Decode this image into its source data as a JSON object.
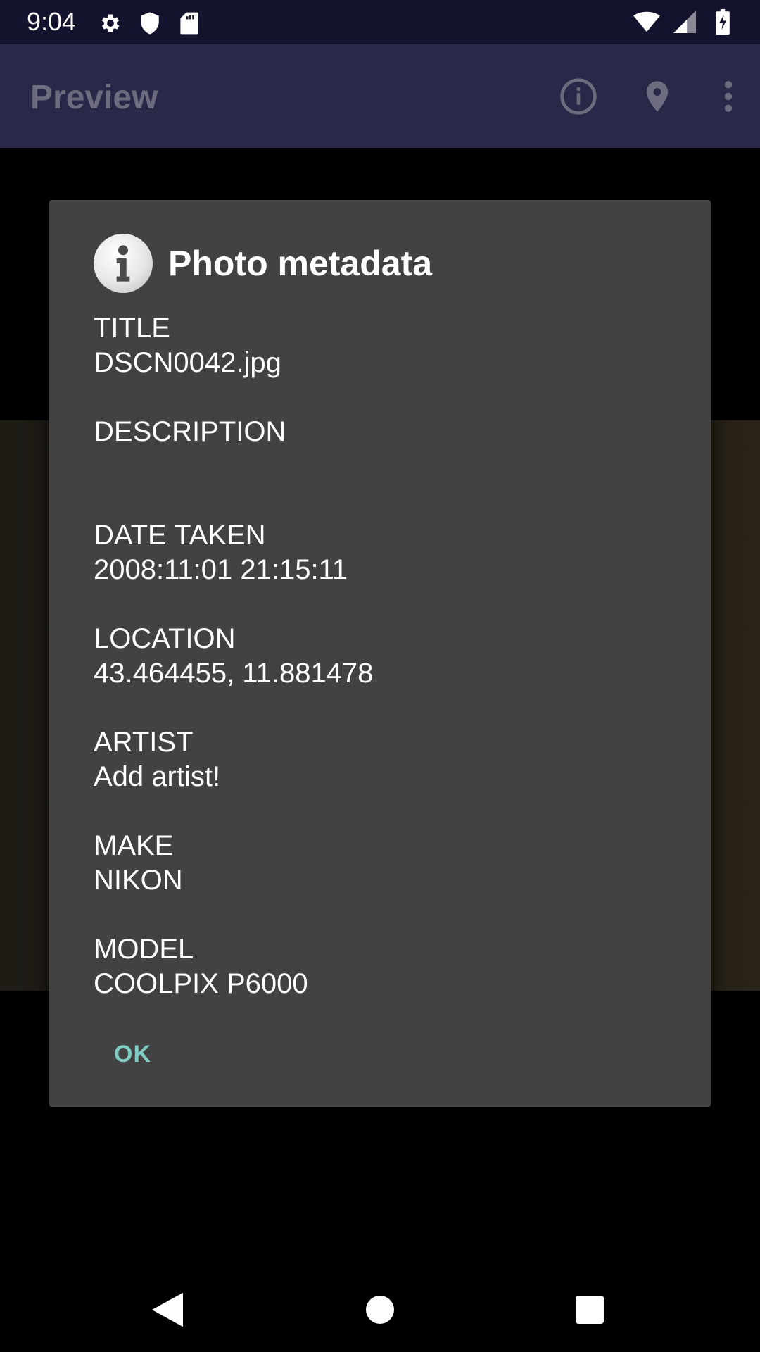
{
  "status_bar": {
    "time": "9:04",
    "left_icons": [
      "settings-icon",
      "shield-icon",
      "sd-card-icon"
    ],
    "right_icons": [
      "wifi-icon",
      "signal-icon",
      "battery-icon"
    ]
  },
  "app_bar": {
    "title": "Preview",
    "actions": [
      "info-icon",
      "location-pin-icon",
      "more-vert-icon"
    ]
  },
  "dialog": {
    "title": "Photo metadata",
    "icon": "info-icon",
    "fields": [
      {
        "label": "TITLE",
        "value": "DSCN0042.jpg"
      },
      {
        "label": "DESCRIPTION",
        "value": ""
      },
      {
        "label": "DATE TAKEN",
        "value": "2008:11:01 21:15:11"
      },
      {
        "label": "LOCATION",
        "value": "43.464455, 11.881478"
      },
      {
        "label": "ARTIST",
        "value": "Add artist!"
      },
      {
        "label": "MAKE",
        "value": "NIKON"
      },
      {
        "label": "MODEL",
        "value": "COOLPIX P6000"
      }
    ],
    "ok_label": "OK",
    "accent_color": "#80cbc4",
    "background_color": "#424242"
  },
  "nav_bar": {
    "buttons": [
      "back-icon",
      "home-icon",
      "recents-icon"
    ]
  }
}
